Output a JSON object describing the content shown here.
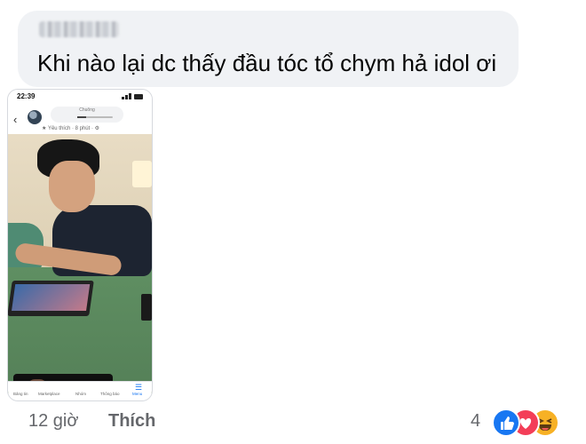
{
  "comment": {
    "author": "",
    "text": "Khi nào lại dc thấy đầu tóc tổ chym hả idol ơi"
  },
  "attachment": {
    "status_time": "22:39",
    "notification_title": "Chuông",
    "post_meta": "★ Yêu thích · 8 phút · ⚙",
    "bottom_nav": [
      "Bảng tin",
      "Marketplace",
      "Nhóm",
      "Thông báo",
      "Menu"
    ]
  },
  "actions": {
    "timestamp": "12 giờ",
    "like_label": "Thích",
    "reaction_count": "4",
    "reactions": [
      "like-icon",
      "love-icon",
      "haha-icon"
    ]
  },
  "colors": {
    "bubble_bg": "#f0f2f5",
    "meta_text": "#65676b",
    "fb_blue": "#1877f2",
    "love_red": "#f33e58",
    "haha_yellow": "#f7b125"
  }
}
